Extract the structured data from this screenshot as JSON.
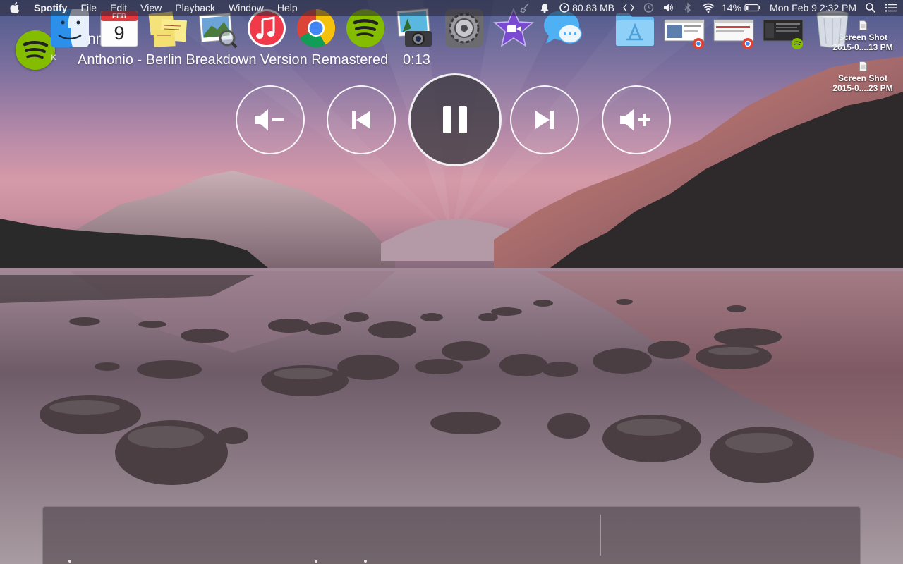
{
  "menubar": {
    "app_name": "Spotify",
    "menus": [
      "File",
      "Edit",
      "View",
      "Playback",
      "Window",
      "Help"
    ],
    "memory": "80.83 MB",
    "battery": "14%",
    "datetime": "Mon Feb 9  2:32 PM"
  },
  "now_playing": {
    "title": "Annie",
    "track": "Anthonio - Berlin Breakdown Version Remastered",
    "time": "0:13",
    "state": "playing",
    "logo_badge": "K"
  },
  "controls": [
    "volume-down",
    "previous",
    "pause",
    "next",
    "volume-up"
  ],
  "desktop_files": [
    {
      "name": "Screen Shot",
      "date": "2015-0....13 PM"
    },
    {
      "name": "Screen Shot",
      "date": "2015-0....23 PM"
    }
  ],
  "dock": {
    "calendar_month": "FEB",
    "calendar_day": "9",
    "apps": [
      "Finder",
      "Calendar",
      "Stickies",
      "Preview",
      "iTunes",
      "Chrome",
      "Spotify",
      "iPhoto",
      "System Preferences",
      "iMovie",
      "Messages"
    ],
    "right_items": [
      "Applications",
      "Chrome window",
      "Chrome window",
      "Spotify window",
      "Trash"
    ]
  },
  "colors": {
    "spotify_green": "#84bd00",
    "itunes_red": "#f03a4a"
  }
}
